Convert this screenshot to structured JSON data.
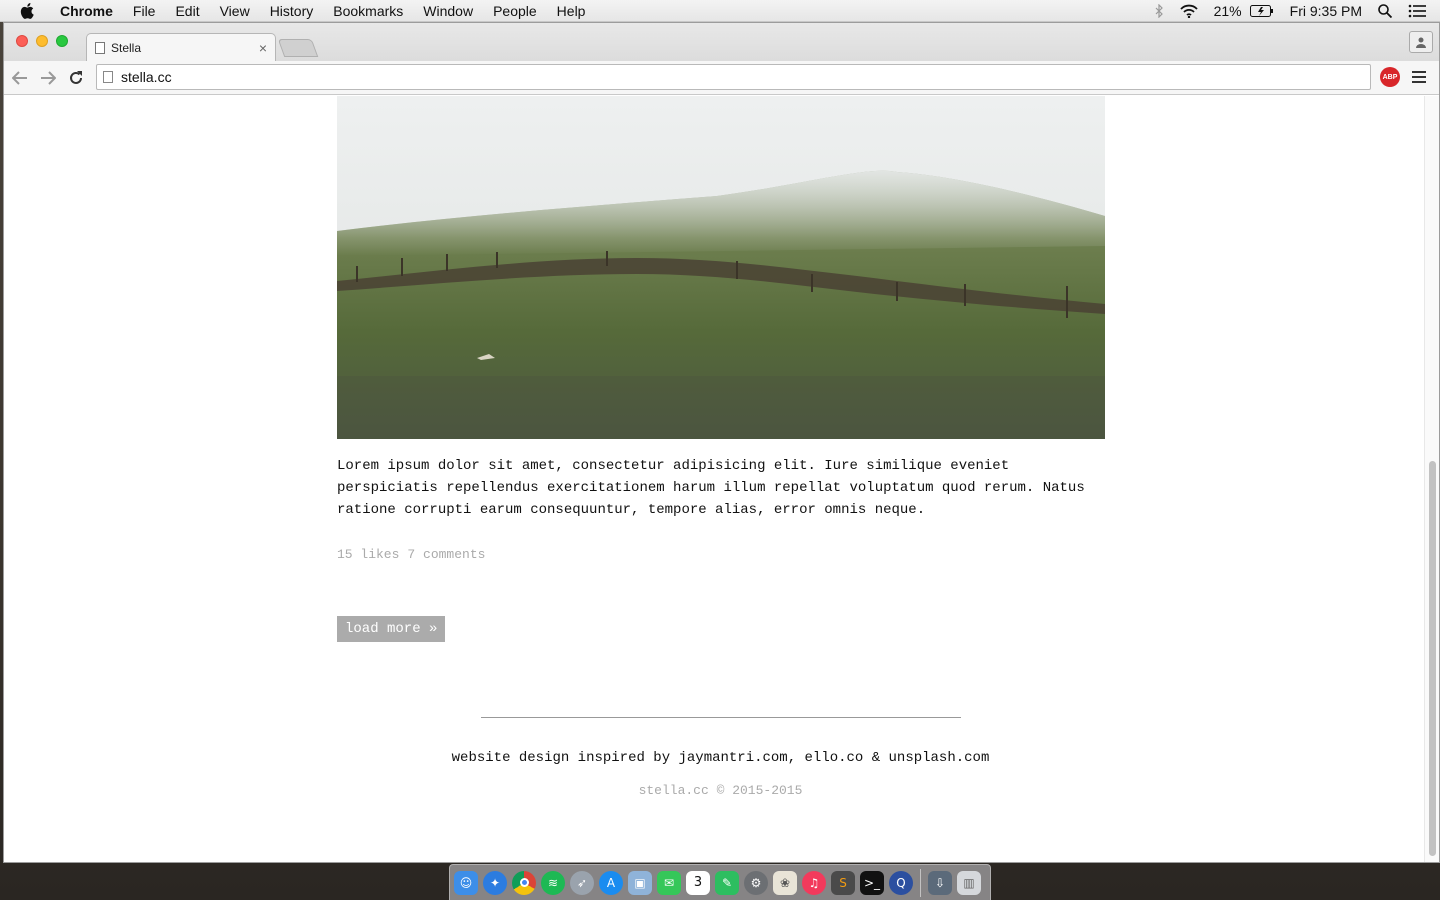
{
  "menubar": {
    "app_name": "Chrome",
    "items": [
      "File",
      "Edit",
      "View",
      "History",
      "Bookmarks",
      "Window",
      "People",
      "Help"
    ],
    "battery": "21%",
    "clock": "Fri 9:35 PM"
  },
  "browser": {
    "tab_title": "Stella",
    "tab_close": "×",
    "url": "stella.cc",
    "adblock_label": "ABP"
  },
  "post": {
    "body": "Lorem ipsum dolor sit amet, consectetur adipisicing elit. Iure similique eveniet perspiciatis repellendus exercitationem harum illum repellat voluptatum quod rerum. Natus ratione corrupti earum consequuntur, tempore alias, error omnis neque.",
    "likes": "15 likes",
    "comments": "7 comments"
  },
  "load_more": "load more »",
  "footer": {
    "credit": "website design inspired by jaymantri.com, ello.co & unsplash.com",
    "copyright": "stella.cc © 2015-2015"
  },
  "dock": {
    "apps": [
      "finder-icon",
      "safari-icon",
      "chrome-icon",
      "spotify-icon",
      "launchpad-icon",
      "app-store-icon",
      "preview-icon",
      "messages-icon",
      "calendar-icon",
      "evernote-icon",
      "system-preferences-icon",
      "photos-icon",
      "itunes-icon",
      "sublime-text-icon",
      "terminal-icon",
      "quicktime-icon",
      "downloads-icon",
      "trash-icon"
    ],
    "calendar_day": "3"
  }
}
